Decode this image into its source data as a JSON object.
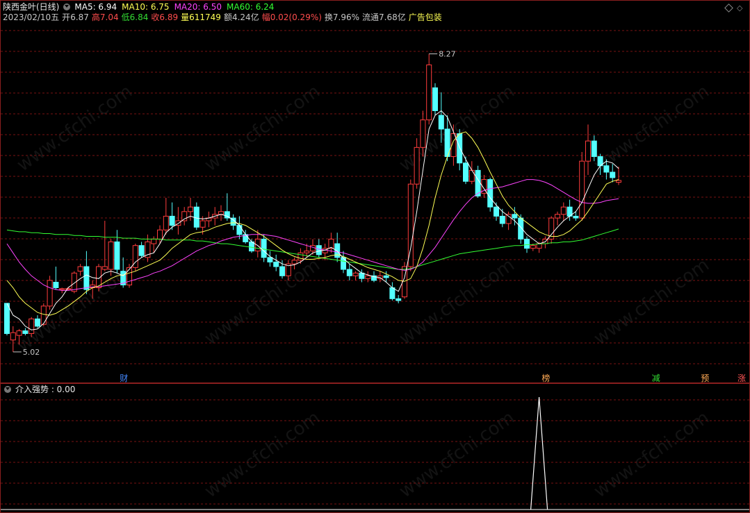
{
  "header": {
    "stock_name": "陕西金叶(日线)",
    "ma_labels": [
      {
        "label": "MA5: 6.94",
        "color": "#ffffff"
      },
      {
        "label": "MA10: 6.75",
        "color": "#ffff55"
      },
      {
        "label": "MA20: 6.50",
        "color": "#ff44ff"
      },
      {
        "label": "MA60: 6.24",
        "color": "#33ff33"
      }
    ],
    "info": {
      "date": "2023/02/10五",
      "open_label": "开",
      "open_value": "6.87",
      "high_label": "高",
      "high_value": "7.04",
      "low_label": "低",
      "low_value": "6.84",
      "close_label": "收",
      "close_value": "6.89",
      "vol_label": "量",
      "vol_value": "611749",
      "amount_label": "额",
      "amount_value": "4.24亿",
      "change_label": "幅",
      "change_value": "0.02(0.29%)",
      "turnover": "换7.96%",
      "float_cap": "流通7.68亿",
      "sector": "广告包装"
    }
  },
  "annotations": {
    "max_label": "8.27",
    "min_label": "5.02"
  },
  "event_tags": [
    {
      "text": "财",
      "color": "#4488ff",
      "bar_index": 19
    },
    {
      "text": "榜",
      "color": "#ffaa55",
      "bar_index": 88
    },
    {
      "text": "减",
      "color": "#33dd33",
      "bar_index": 106
    },
    {
      "text": "预",
      "color": "#ffaa55",
      "bar_index": 114
    },
    {
      "text": "涨",
      "color": "#ff5555",
      "bar_index": 120
    }
  ],
  "sub_panel": {
    "indicator_label": "介入强势 : 0.00"
  },
  "watermark": "www.cfchi.com",
  "colors": {
    "up": "#ff3c3c",
    "down": "#54ffff",
    "ma5": "#ffffff",
    "ma10": "#ffff55",
    "ma20": "#ff44ff",
    "ma60": "#33ff33",
    "grid": "#7a1212",
    "border": "#8a1e1e"
  },
  "chart_data": [
    {
      "type": "candlestick",
      "title": "陕西金叶(日线)",
      "ylim": [
        4.8,
        8.6
      ],
      "grid": true,
      "ohlc": [
        [
          5.55,
          5.55,
          5.2,
          5.22
        ],
        [
          5.15,
          5.3,
          5.02,
          5.23
        ],
        [
          5.2,
          5.27,
          5.1,
          5.25
        ],
        [
          5.25,
          5.28,
          5.2,
          5.22
        ],
        [
          5.22,
          5.4,
          5.18,
          5.38
        ],
        [
          5.38,
          5.42,
          5.28,
          5.3
        ],
        [
          5.32,
          5.55,
          5.3,
          5.52
        ],
        [
          5.52,
          5.85,
          5.48,
          5.8
        ],
        [
          5.78,
          5.95,
          5.7,
          5.72
        ],
        [
          5.7,
          5.72,
          5.66,
          5.71
        ],
        [
          5.71,
          5.73,
          5.69,
          5.71
        ],
        [
          5.68,
          5.9,
          5.66,
          5.88
        ],
        [
          5.9,
          5.98,
          5.85,
          5.95
        ],
        [
          5.95,
          6.12,
          5.65,
          5.7
        ],
        [
          5.72,
          5.8,
          5.6,
          5.75
        ],
        [
          5.72,
          5.98,
          5.68,
          5.95
        ],
        [
          5.92,
          6.45,
          5.9,
          5.95
        ],
        [
          5.92,
          6.25,
          5.85,
          6.22
        ],
        [
          6.22,
          6.35,
          5.88,
          5.92
        ],
        [
          5.9,
          6.05,
          5.72,
          5.75
        ],
        [
          5.75,
          5.98,
          5.72,
          5.94
        ],
        [
          5.94,
          6.2,
          5.9,
          6.18
        ],
        [
          6.18,
          6.22,
          6.05,
          6.07
        ],
        [
          6.05,
          6.3,
          6.0,
          6.22
        ],
        [
          6.2,
          6.28,
          6.1,
          6.25
        ],
        [
          6.25,
          6.4,
          6.2,
          6.35
        ],
        [
          6.35,
          6.7,
          6.3,
          6.5
        ],
        [
          6.5,
          6.65,
          6.35,
          6.4
        ],
        [
          6.4,
          6.6,
          6.3,
          6.45
        ],
        [
          6.45,
          6.6,
          6.4,
          6.55
        ],
        [
          6.55,
          6.7,
          6.45,
          6.6
        ],
        [
          6.6,
          6.65,
          6.35,
          6.38
        ],
        [
          6.38,
          6.5,
          6.3,
          6.45
        ],
        [
          6.45,
          6.55,
          6.38,
          6.48
        ],
        [
          6.48,
          6.6,
          6.4,
          6.52
        ],
        [
          6.52,
          6.62,
          6.45,
          6.55
        ],
        [
          6.55,
          6.75,
          6.45,
          6.48
        ],
        [
          6.48,
          6.52,
          6.35,
          6.4
        ],
        [
          6.4,
          6.5,
          6.25,
          6.3
        ],
        [
          6.3,
          6.35,
          6.2,
          6.22
        ],
        [
          6.22,
          6.25,
          6.1,
          6.12
        ],
        [
          6.12,
          6.35,
          6.05,
          6.25
        ],
        [
          6.25,
          6.3,
          6.0,
          6.05
        ],
        [
          6.05,
          6.12,
          5.95,
          6.0
        ],
        [
          6.0,
          6.08,
          5.9,
          5.95
        ],
        [
          5.95,
          6.02,
          5.82,
          5.85
        ],
        [
          5.85,
          6.02,
          5.8,
          5.98
        ],
        [
          5.98,
          6.05,
          5.92,
          6.02
        ],
        [
          6.02,
          6.15,
          5.98,
          6.1
        ],
        [
          6.1,
          6.2,
          6.05,
          6.12
        ],
        [
          6.12,
          6.25,
          6.08,
          6.18
        ],
        [
          6.18,
          6.25,
          6.05,
          6.08
        ],
        [
          6.1,
          6.2,
          6.02,
          6.15
        ],
        [
          6.15,
          6.32,
          6.1,
          6.25
        ],
        [
          6.2,
          6.32,
          6.0,
          6.05
        ],
        [
          6.05,
          6.12,
          5.88,
          5.92
        ],
        [
          5.92,
          5.98,
          5.8,
          5.85
        ],
        [
          5.85,
          5.9,
          5.8,
          5.88
        ],
        [
          5.88,
          5.92,
          5.78,
          5.82
        ],
        [
          5.82,
          5.9,
          5.78,
          5.85
        ],
        [
          5.85,
          5.9,
          5.78,
          5.8
        ],
        [
          5.82,
          5.9,
          5.78,
          5.85
        ],
        [
          5.85,
          5.9,
          5.78,
          5.83
        ],
        [
          5.72,
          5.78,
          5.58,
          5.6
        ],
        [
          5.6,
          5.64,
          5.55,
          5.58
        ],
        [
          5.62,
          6.0,
          5.6,
          5.95
        ],
        [
          5.95,
          6.9,
          5.9,
          6.85
        ],
        [
          6.85,
          7.35,
          6.8,
          7.25
        ],
        [
          7.25,
          7.65,
          7.15,
          7.55
        ],
        [
          7.55,
          8.27,
          7.5,
          8.15
        ],
        [
          7.9,
          7.95,
          7.6,
          7.65
        ],
        [
          7.6,
          7.85,
          7.3,
          7.45
        ],
        [
          7.45,
          7.6,
          7.1,
          7.15
        ],
        [
          7.15,
          7.5,
          7.05,
          7.4
        ],
        [
          7.4,
          7.45,
          7.0,
          7.08
        ],
        [
          7.08,
          7.15,
          6.85,
          6.88
        ],
        [
          6.88,
          7.1,
          6.85,
          7.0
        ],
        [
          7.0,
          7.05,
          6.7,
          6.72
        ],
        [
          6.75,
          6.95,
          6.7,
          6.9
        ],
        [
          6.9,
          6.92,
          6.55,
          6.6
        ],
        [
          6.6,
          6.65,
          6.45,
          6.5
        ],
        [
          6.5,
          6.58,
          6.38,
          6.42
        ],
        [
          6.42,
          6.55,
          6.35,
          6.52
        ],
        [
          6.52,
          6.6,
          6.4,
          6.48
        ],
        [
          6.48,
          6.52,
          6.2,
          6.25
        ],
        [
          6.25,
          6.28,
          6.1,
          6.15
        ],
        [
          6.15,
          6.2,
          6.12,
          6.18
        ],
        [
          6.15,
          6.22,
          6.1,
          6.2
        ],
        [
          6.2,
          6.28,
          6.15,
          6.25
        ],
        [
          6.25,
          6.5,
          6.2,
          6.48
        ],
        [
          6.48,
          6.55,
          6.4,
          6.52
        ],
        [
          6.52,
          6.65,
          6.45,
          6.6
        ],
        [
          6.6,
          6.68,
          6.45,
          6.5
        ],
        [
          6.5,
          6.55,
          6.45,
          6.48
        ],
        [
          6.48,
          7.2,
          6.45,
          7.1
        ],
        [
          7.1,
          7.5,
          6.95,
          7.32
        ],
        [
          7.32,
          7.38,
          7.1,
          7.15
        ],
        [
          7.15,
          7.18,
          6.95,
          7.05
        ],
        [
          7.05,
          7.12,
          6.9,
          6.98
        ],
        [
          6.98,
          7.07,
          6.87,
          6.92
        ],
        [
          6.87,
          7.04,
          6.84,
          6.89
        ]
      ],
      "ma5": [
        5.55,
        5.42,
        5.38,
        5.3,
        5.26,
        5.27,
        5.33,
        5.44,
        5.55,
        5.62,
        5.72,
        5.77,
        5.82,
        5.86,
        5.83,
        5.82,
        5.88,
        5.9,
        5.88,
        5.85,
        5.92,
        6.0,
        6.05,
        6.08,
        6.1,
        6.2,
        6.32,
        6.38,
        6.42,
        6.47,
        6.5,
        6.48,
        6.47,
        6.48,
        6.5,
        6.52,
        6.5,
        6.46,
        6.4,
        6.3,
        6.22,
        6.18,
        6.12,
        6.06,
        6.02,
        5.98,
        5.96,
        5.97,
        6.0,
        6.05,
        6.1,
        6.12,
        6.13,
        6.16,
        6.12,
        6.04,
        5.98,
        5.93,
        5.88,
        5.86,
        5.84,
        5.83,
        5.78,
        5.72,
        5.68,
        5.83,
        6.15,
        6.55,
        7.0,
        7.45,
        7.6,
        7.65,
        7.58,
        7.42,
        7.25,
        7.12,
        7.0,
        6.9,
        6.8,
        6.7,
        6.62,
        6.55,
        6.5,
        6.45,
        6.38,
        6.3,
        6.25,
        6.2,
        6.22,
        6.3,
        6.38,
        6.45,
        6.5,
        6.55,
        6.65,
        6.8,
        6.95,
        7.05,
        7.1,
        7.08,
        7.02
      ],
      "ma10": [
        5.8,
        5.72,
        5.62,
        5.55,
        5.5,
        5.45,
        5.43,
        5.42,
        5.44,
        5.48,
        5.52,
        5.57,
        5.62,
        5.68,
        5.72,
        5.74,
        5.78,
        5.82,
        5.85,
        5.86,
        5.88,
        5.9,
        5.93,
        5.96,
        5.99,
        6.02,
        6.08,
        6.15,
        6.2,
        6.25,
        6.3,
        6.32,
        6.33,
        6.35,
        6.38,
        6.4,
        6.42,
        6.43,
        6.42,
        6.4,
        6.36,
        6.32,
        6.28,
        6.23,
        6.18,
        6.13,
        6.09,
        6.06,
        6.04,
        6.03,
        6.03,
        6.04,
        6.05,
        6.07,
        6.08,
        6.06,
        6.03,
        6.0,
        5.97,
        5.94,
        5.92,
        5.9,
        5.87,
        5.84,
        5.8,
        5.79,
        5.82,
        5.95,
        6.15,
        6.4,
        6.7,
        6.95,
        7.15,
        7.32,
        7.4,
        7.42,
        7.35,
        7.25,
        7.12,
        6.98,
        6.85,
        6.72,
        6.62,
        6.55,
        6.48,
        6.43,
        6.38,
        6.33,
        6.3,
        6.28,
        6.28,
        6.3,
        6.34,
        6.4,
        6.46,
        6.55,
        6.65,
        6.75,
        6.85,
        6.88,
        6.9
      ],
      "ma20": [
        6.2,
        6.1,
        6.0,
        5.92,
        5.85,
        5.8,
        5.75,
        5.72,
        5.7,
        5.69,
        5.69,
        5.7,
        5.71,
        5.72,
        5.73,
        5.73,
        5.74,
        5.75,
        5.76,
        5.77,
        5.79,
        5.81,
        5.83,
        5.85,
        5.88,
        5.9,
        5.93,
        5.96,
        6.0,
        6.04,
        6.08,
        6.12,
        6.15,
        6.18,
        6.2,
        6.23,
        6.25,
        6.27,
        6.28,
        6.29,
        6.3,
        6.3,
        6.3,
        6.29,
        6.28,
        6.26,
        6.24,
        6.22,
        6.2,
        6.18,
        6.16,
        6.14,
        6.13,
        6.12,
        6.11,
        6.1,
        6.08,
        6.06,
        6.04,
        6.02,
        6.0,
        5.98,
        5.96,
        5.94,
        5.92,
        5.91,
        5.92,
        5.95,
        6.0,
        6.08,
        6.16,
        6.26,
        6.36,
        6.46,
        6.55,
        6.63,
        6.7,
        6.75,
        6.78,
        6.8,
        6.81,
        6.82,
        6.84,
        6.86,
        6.88,
        6.9,
        6.9,
        6.89,
        6.87,
        6.84,
        6.8,
        6.76,
        6.72,
        6.68,
        6.65,
        6.64,
        6.64,
        6.65,
        6.67,
        6.68,
        6.69
      ],
      "ma60": [
        6.35,
        6.34,
        6.33,
        6.33,
        6.32,
        6.32,
        6.31,
        6.31,
        6.3,
        6.3,
        6.3,
        6.29,
        6.29,
        6.28,
        6.28,
        6.28,
        6.27,
        6.27,
        6.27,
        6.26,
        6.26,
        6.26,
        6.25,
        6.25,
        6.25,
        6.25,
        6.24,
        6.24,
        6.24,
        6.24,
        6.24,
        6.23,
        6.23,
        6.22,
        6.21,
        6.2,
        6.2,
        6.19,
        6.18,
        6.17,
        6.16,
        6.15,
        6.14,
        6.13,
        6.12,
        6.11,
        6.1,
        6.09,
        6.08,
        6.07,
        6.06,
        6.05,
        6.04,
        6.03,
        6.02,
        6.01,
        6.0,
        5.99,
        5.98,
        5.97,
        5.96,
        5.95,
        5.94,
        5.93,
        5.92,
        5.92,
        5.93,
        5.95,
        5.97,
        5.99,
        6.01,
        6.03,
        6.05,
        6.07,
        6.09,
        6.1,
        6.11,
        6.12,
        6.13,
        6.14,
        6.15,
        6.16,
        6.17,
        6.18,
        6.18,
        6.19,
        6.19,
        6.2,
        6.2,
        6.21,
        6.21,
        6.22,
        6.22,
        6.23,
        6.24,
        6.26,
        6.28,
        6.3,
        6.32,
        6.34,
        6.36
      ]
    },
    {
      "type": "line",
      "title": "介入强势",
      "ylim": [
        0,
        1
      ],
      "series": [
        {
          "name": "介入强势",
          "spike_bar_index": 87,
          "spike_value": 1
        }
      ]
    }
  ]
}
